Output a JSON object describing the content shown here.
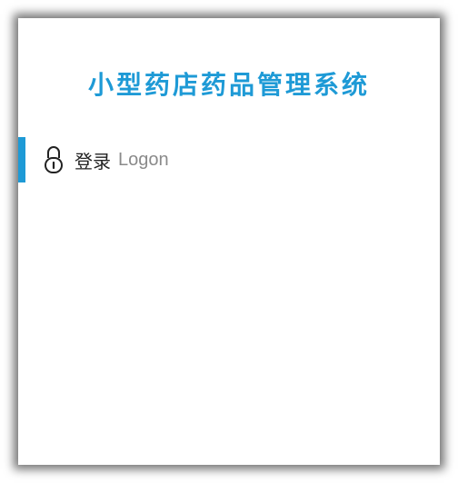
{
  "header": {
    "title": "小型药店药品管理系统"
  },
  "login": {
    "label_cn": "登录",
    "label_en": "Logon",
    "icon": "lock-icon"
  },
  "colors": {
    "accent": "#1e9ad6",
    "text_dark": "#222222",
    "text_muted": "#8a8a8a"
  }
}
